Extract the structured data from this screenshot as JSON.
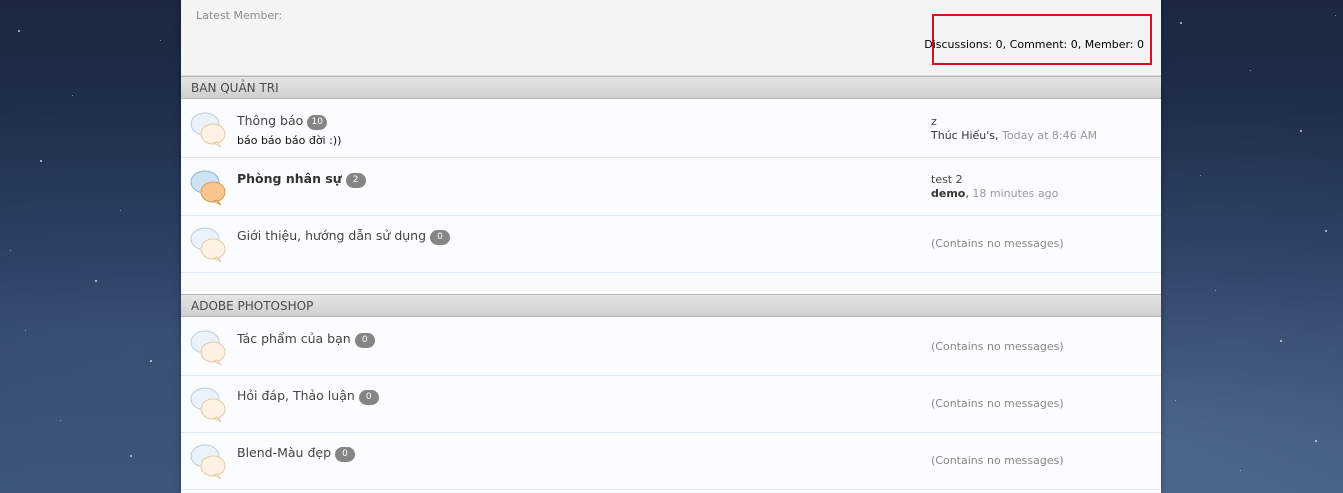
{
  "stats": {
    "latest_member_label": "Latest Member:",
    "summary": "Discussions: 0, Comment: 0, Member: 0"
  },
  "categories": [
    {
      "title": "BAN QUẢN TRI",
      "forums": [
        {
          "title": "Thông báo",
          "count": "10",
          "description": "báo báo báo đời :))",
          "last_post_title": "z",
          "last_post_user": "Thúc Hiếu's",
          "last_post_time": "Today at 8:46 AM"
        },
        {
          "title": "Phòng nhân sự",
          "count": "2",
          "last_post_title": "test 2",
          "last_post_user": "demo",
          "last_post_time": "18 minutes ago"
        },
        {
          "title": "Giới thiệu, hướng dẫn sử dụng",
          "count": "0",
          "no_messages": "(Contains no messages)"
        }
      ]
    },
    {
      "title": "ADOBE PHOTOSHOP",
      "forums": [
        {
          "title": "Tác phẩm của bạn",
          "count": "0",
          "no_messages": "(Contains no messages)"
        },
        {
          "title": "Hỏi đáp, Thảo luận",
          "count": "0",
          "no_messages": "(Contains no messages)"
        },
        {
          "title": "Blend-Màu đẹp",
          "count": "0",
          "no_messages": "(Contains no messages)"
        }
      ]
    }
  ],
  "colors": {
    "highlight_box": "#d4161c",
    "badge": "#858585",
    "row_divider": "#dfe9f4"
  },
  "icons": {
    "forum_read": "speech-bubbles-icon",
    "forum_unread": "speech-bubbles-unread-icon"
  }
}
